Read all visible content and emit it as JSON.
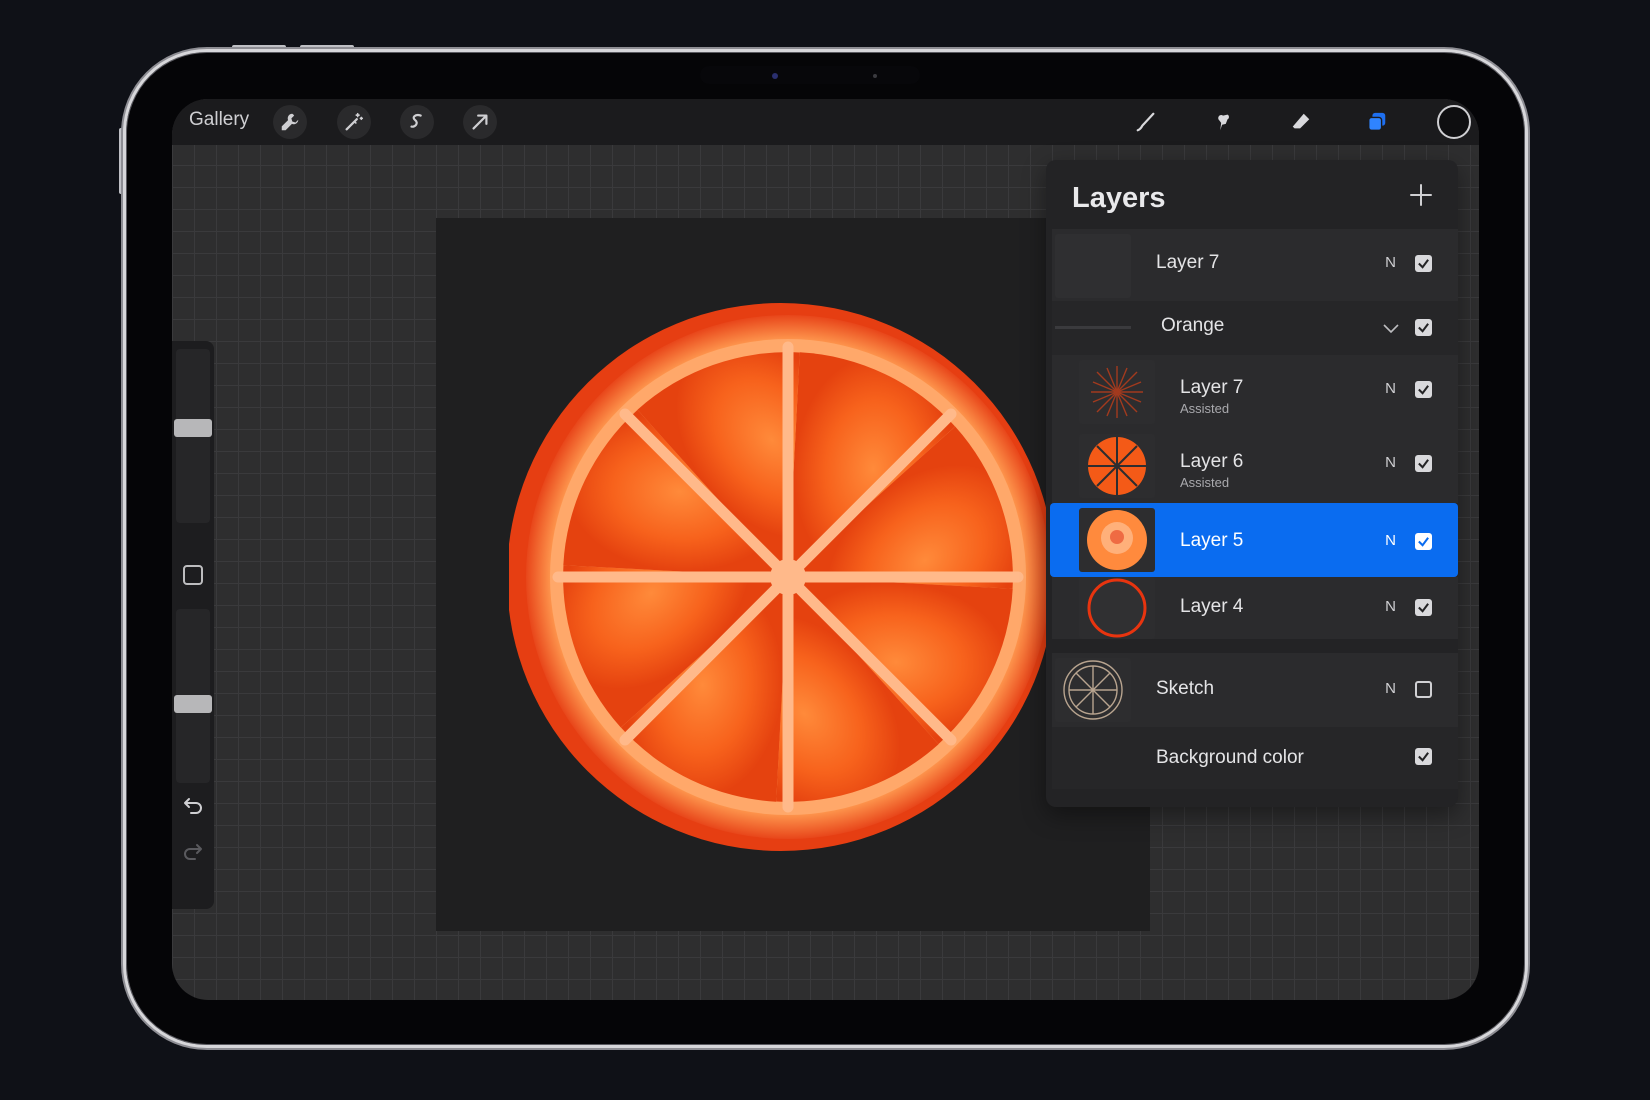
{
  "toolbar": {
    "gallery_label": "Gallery",
    "left_tools": [
      "wrench-icon",
      "magic-wand-icon",
      "selection-icon",
      "transform-arrow-icon"
    ],
    "right_tools": [
      "brush-icon",
      "smudge-icon",
      "eraser-icon",
      "layers-icon",
      "color-swatch"
    ],
    "accent_color": "#0a6cf0"
  },
  "layers_panel": {
    "title": "Layers",
    "add_icon": "plus-icon",
    "layers": [
      {
        "name": "Layer 7",
        "subtitle": "",
        "blend": "N",
        "visible": true,
        "selected": false,
        "thumb": "dark"
      },
      {
        "name": "Orange",
        "subtitle": "",
        "blend": "",
        "visible": true,
        "selected": false,
        "thumb": "group",
        "group": true
      },
      {
        "name": "Layer 7",
        "subtitle": "Assisted",
        "blend": "N",
        "visible": true,
        "selected": false,
        "thumb": "rays"
      },
      {
        "name": "Layer 6",
        "subtitle": "Assisted",
        "blend": "N",
        "visible": true,
        "selected": false,
        "thumb": "segments"
      },
      {
        "name": "Layer 5",
        "subtitle": "",
        "blend": "N",
        "visible": true,
        "selected": true,
        "thumb": "orange-disc"
      },
      {
        "name": "Layer 4",
        "subtitle": "",
        "blend": "N",
        "visible": true,
        "selected": false,
        "thumb": "red-ring"
      },
      {
        "name": "Sketch",
        "subtitle": "",
        "blend": "N",
        "visible": false,
        "selected": false,
        "thumb": "sketch"
      },
      {
        "name": "Background color",
        "subtitle": "",
        "blend": "",
        "visible": true,
        "selected": false,
        "thumb": "none"
      }
    ]
  },
  "sidebar": {
    "brush_size_level": 0.55,
    "opacity_level": 0.45,
    "undo_icon": "undo-icon",
    "redo_icon": "redo-icon"
  }
}
